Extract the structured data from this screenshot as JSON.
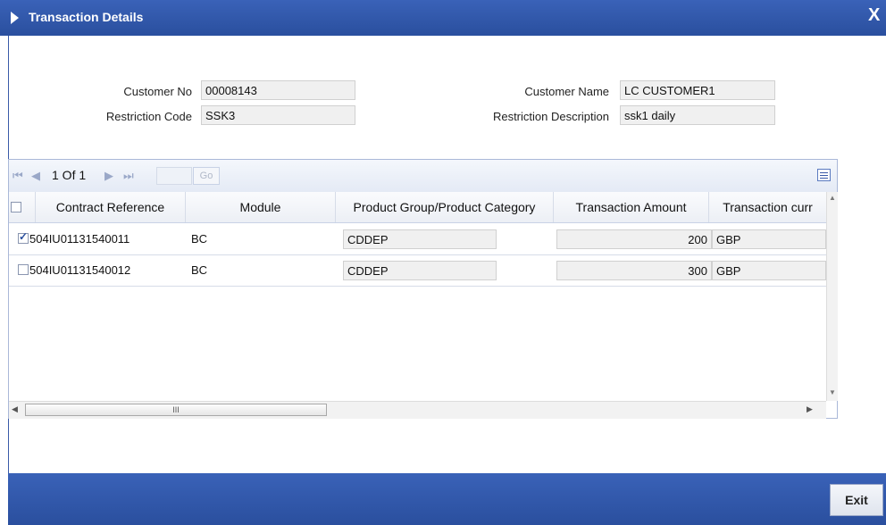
{
  "window": {
    "title": "Transaction Details",
    "close_label": "X"
  },
  "form": {
    "customer_no_label": "Customer No",
    "customer_no": "00008143",
    "restriction_code_label": "Restriction Code",
    "restriction_code": "SSK3",
    "customer_name_label": "Customer Name",
    "customer_name": "LC CUSTOMER1",
    "restriction_desc_label": "Restriction Description",
    "restriction_desc": "ssk1 daily"
  },
  "pager": {
    "text": "1 Of 1",
    "go_label": "Go"
  },
  "table": {
    "headers": [
      "Contract Reference",
      "Module",
      "Product Group/Product Category",
      "Transaction Amount",
      "Transaction curr"
    ],
    "rows": [
      {
        "checked": true,
        "contract": "504IU01131540011",
        "module": "BC",
        "product": "CDDEP",
        "amount": "200",
        "currency": "GBP"
      },
      {
        "checked": false,
        "contract": "504IU01131540012",
        "module": "BC",
        "product": "CDDEP",
        "amount": "300",
        "currency": "GBP"
      }
    ],
    "hscroll_thumb": "III"
  },
  "footer": {
    "exit_label": "Exit"
  },
  "colors": {
    "titlebar": "#2a4f9e",
    "footer": "#2a4f9e"
  }
}
